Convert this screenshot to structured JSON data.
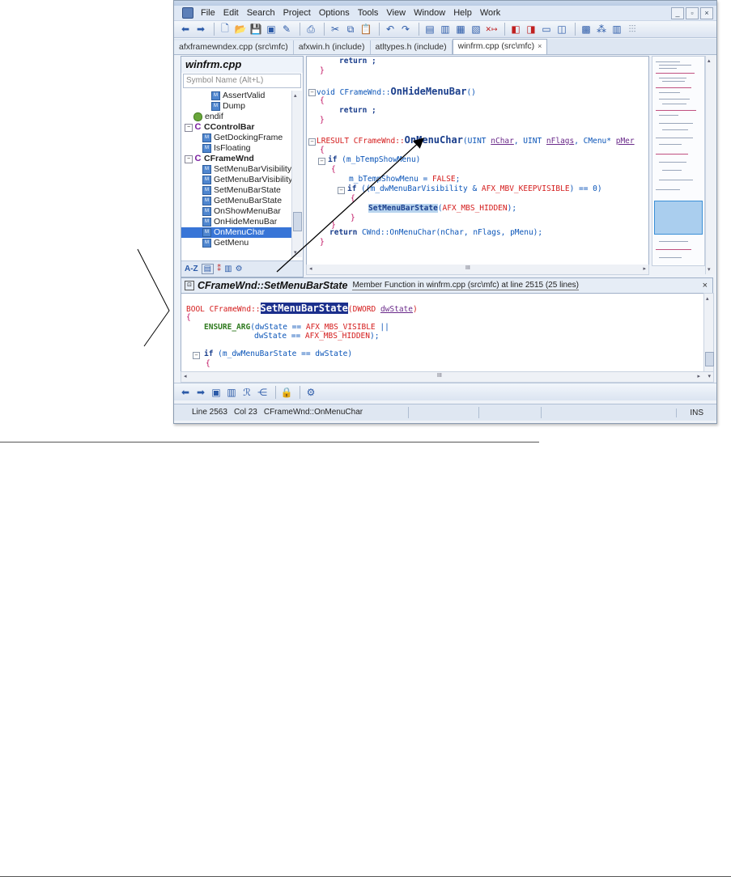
{
  "menu": {
    "items": [
      "File",
      "Edit",
      "Search",
      "Project",
      "Options",
      "Tools",
      "View",
      "Window",
      "Help",
      "Work"
    ]
  },
  "window_controls": {
    "minimize": "_",
    "restore": "▫",
    "close": "×"
  },
  "tabs": [
    {
      "label": "afxframewndex.cpp (src\\mfc)",
      "active": false
    },
    {
      "label": "afxwin.h (include)",
      "active": false
    },
    {
      "label": "atltypes.h (include)",
      "active": false
    },
    {
      "label": "winfrm.cpp (src\\mfc)",
      "active": true,
      "close": "×"
    }
  ],
  "symbols": {
    "title": "winfrm.cpp",
    "search_placeholder": "Symbol Name (Alt+L)",
    "items": [
      {
        "label": "AssertValid",
        "kind": "method",
        "indent": 3
      },
      {
        "label": "Dump",
        "kind": "method",
        "indent": 3
      },
      {
        "label": "endif",
        "kind": "directive",
        "indent": 1
      },
      {
        "label": "CControlBar",
        "kind": "class",
        "indent": 0,
        "bold": true
      },
      {
        "label": "GetDockingFrame",
        "kind": "method",
        "indent": 2
      },
      {
        "label": "IsFloating",
        "kind": "method",
        "indent": 2
      },
      {
        "label": "CFrameWnd",
        "kind": "class",
        "indent": 0,
        "bold": true
      },
      {
        "label": "SetMenuBarVisibility",
        "kind": "method",
        "indent": 2
      },
      {
        "label": "GetMenuBarVisibility",
        "kind": "method",
        "indent": 2
      },
      {
        "label": "SetMenuBarState",
        "kind": "method",
        "indent": 2
      },
      {
        "label": "GetMenuBarState",
        "kind": "method",
        "indent": 2
      },
      {
        "label": "OnShowMenuBar",
        "kind": "method",
        "indent": 2
      },
      {
        "label": "OnHideMenuBar",
        "kind": "method",
        "indent": 2
      },
      {
        "label": "OnMenuChar",
        "kind": "method",
        "indent": 2,
        "selected": true
      },
      {
        "label": "GetMenu",
        "kind": "method",
        "indent": 2
      }
    ],
    "toolbar": {
      "az": "A-Z"
    }
  },
  "editor": {
    "l1": "return ;",
    "l2": "}",
    "l3a": "void CFrameWnd::",
    "l3b": "OnHideMenuBar",
    "l3c": "()",
    "l4": "{",
    "l5": "return ;",
    "l6": "}",
    "l7a": "LRESULT CFrameWnd::",
    "l7b": "OnMenuChar",
    "l7c": "(UINT ",
    "l7d": "nChar",
    "l7e": ", UINT ",
    "l7f": "nFlags",
    "l7g": ", CMenu* ",
    "l7h": "pMer",
    "l8": "{",
    "l9a": "if",
    "l9b": " (m_bTempShowMenu)",
    "l10": "{",
    "l11a": "m_bTempShowMenu = ",
    "l11b": "FALSE",
    "l11c": ";",
    "l12a": "if",
    "l12b": " ((m_dwMenuBarVisibility & ",
    "l12c": "AFX_MBV_KEEPVISIBLE",
    "l12d": ") == 0)",
    "l13": "{",
    "l14a": "SetMenuBarState",
    "l14b": "(",
    "l14c": "AFX_MBS_HIDDEN",
    "l14d": ");",
    "l15": "}",
    "l16": "}",
    "l17a": "return ",
    "l17b": "CWnd::OnMenuChar(nChar, nFlags, pMenu);",
    "l18": "}"
  },
  "scroll_marks": {
    "mid": "III",
    "left": "◂",
    "right": "▸",
    "up": "▴",
    "down": "▾"
  },
  "preview": {
    "title": "CFrameWnd::SetMenuBarState",
    "description": "Member Function in winfrm.cpp (src\\mfc) at line 2515 (25 lines)",
    "close": "×",
    "c1a": "BOOL CFrameWnd::",
    "c1b": "SetMenuBarState",
    "c1c": "(DWORD ",
    "c1d": "dwState",
    "c1e": ")",
    "c2": "{",
    "c3a": "ENSURE_ARG",
    "c3b": "(dwState == ",
    "c3c": "AFX_MBS_VISIBLE",
    "c3d": " ||",
    "c4a": "dwState == ",
    "c4b": "AFX_MBS_HIDDEN",
    "c4c": ");",
    "c5a": "if",
    "c5b": " (m_dwMenuBarState == dwState)",
    "c6": "{"
  },
  "status": {
    "line": "Line 2563",
    "col": "Col 23",
    "symbol": "CFrameWnd::OnMenuChar",
    "mode": "INS"
  },
  "colors": {
    "accent": "#3875d7",
    "preview_highlight": "#1b2f8c",
    "macro": "#d41c1c"
  }
}
